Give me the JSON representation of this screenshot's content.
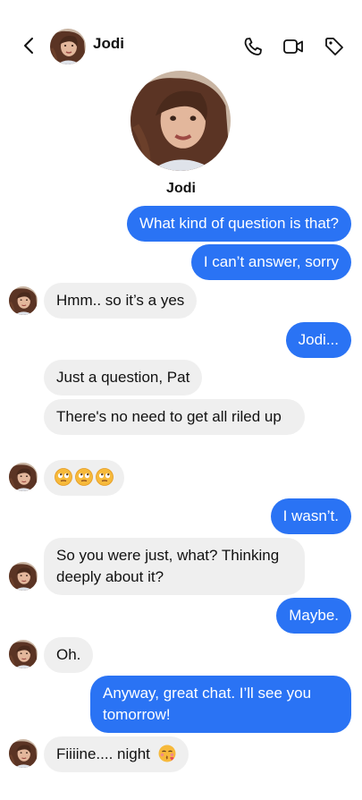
{
  "header": {
    "contact_name": "Jodi",
    "icons": [
      "back-chevron-icon",
      "phone-icon",
      "video-camera-icon",
      "tag-icon"
    ]
  },
  "profile": {
    "name": "Jodi"
  },
  "colors": {
    "outgoing": "#2a73f4",
    "incoming": "#efefef",
    "text_dark": "#111111"
  },
  "messages": [
    {
      "from": "me",
      "text": "What kind of question is that?"
    },
    {
      "from": "me",
      "text": "I can’t answer, sorry"
    },
    {
      "from": "jodi",
      "text": "Hmm.. so it’s a yes"
    },
    {
      "from": "me",
      "text": "Jodi..."
    },
    {
      "from": "jodi",
      "text": "Just a question, Pat"
    },
    {
      "from": "jodi",
      "text": "There's no need to get all riled up"
    },
    {
      "from": "jodi",
      "text": "",
      "emoji": [
        "face-with-rolling-eyes",
        "face-with-rolling-eyes",
        "face-with-rolling-eyes"
      ]
    },
    {
      "from": "me",
      "text": "I wasn’t."
    },
    {
      "from": "jodi",
      "text": "So you were just, what? Thinking deeply about it?"
    },
    {
      "from": "me",
      "text": "Maybe."
    },
    {
      "from": "jodi",
      "text": "Oh."
    },
    {
      "from": "me",
      "text": "Anyway, great chat. I’ll see you tomorrow!"
    },
    {
      "from": "jodi",
      "text": "Fiiiine.... night",
      "emoji": [
        "face-blowing-kiss"
      ]
    }
  ]
}
